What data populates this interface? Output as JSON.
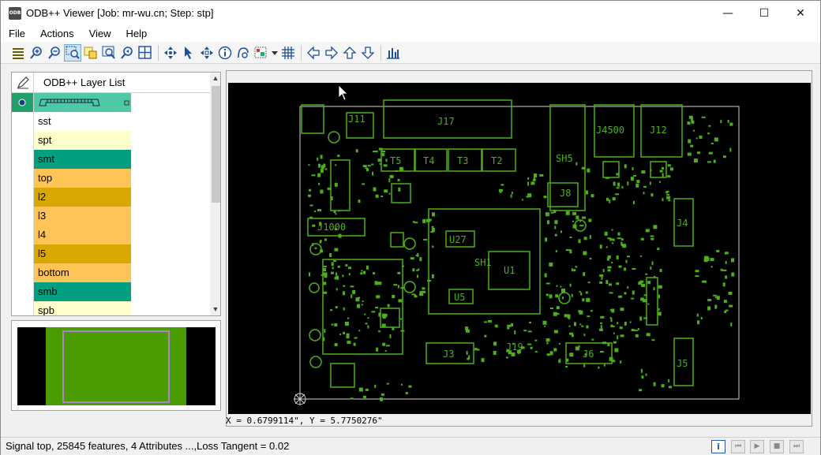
{
  "window": {
    "app_icon_text": "ODB",
    "title": "ODB++ Viewer [Job: mr-wu.cn; Step: stp]",
    "minimize": "—",
    "maximize": "☐",
    "close": "✕"
  },
  "menu": [
    "File",
    "Actions",
    "View",
    "Help"
  ],
  "toolbar": {
    "icons": [
      "layers-icon",
      "zoom-in-icon",
      "zoom-out-icon",
      "zoom-window-icon",
      "zoom-selected-icon",
      "zoom-fit-icon",
      "zoom-previous-icon",
      "panel-layout-icon",
      "sep",
      "move-icon",
      "select-pointer-icon",
      "multi-move-icon",
      "info-icon",
      "measure-icon",
      "highlight-icon",
      "dropdown-arrow-icon",
      "grid-icon",
      "sep",
      "pan-left-icon",
      "pan-right-icon",
      "pan-up-icon",
      "pan-down-icon",
      "sep",
      "histogram-icon"
    ]
  },
  "layer_panel": {
    "header_title": "ODB++ Layer List",
    "layers": [
      {
        "name": "",
        "color": "#4fc9a5",
        "selected": true
      },
      {
        "name": "sst",
        "color": "#ffffff"
      },
      {
        "name": "spt",
        "color": "#ffffcc"
      },
      {
        "name": "smt",
        "color": "#00a080"
      },
      {
        "name": "top",
        "color": "#ffc457"
      },
      {
        "name": "l2",
        "color": "#d9a800"
      },
      {
        "name": "l3",
        "color": "#ffc457"
      },
      {
        "name": "l4",
        "color": "#ffc457"
      },
      {
        "name": "l5",
        "color": "#d9a800"
      },
      {
        "name": "bottom",
        "color": "#ffc457"
      },
      {
        "name": "smb",
        "color": "#00a080"
      },
      {
        "name": "spb",
        "color": "#ffffcc"
      }
    ]
  },
  "board": {
    "trace_color": "#4db01a",
    "labels": [
      "J11",
      "J17",
      "T5",
      "T4",
      "T3",
      "T2",
      "SH5",
      "J4500",
      "J12",
      "J8",
      "J1000",
      "U27",
      "SH1",
      "U1",
      "U5",
      "J4",
      "J3",
      "J19",
      "J6",
      "J5"
    ]
  },
  "coordinates": "X = 0.6799114\", Y = 5.7750276\"",
  "status": {
    "text": "Signal top, 25845 features, 4 Attributes ...,Loss Tangent = 0.02",
    "info_label": "i",
    "nav": [
      "⏮",
      "▶",
      "■",
      "⏭"
    ]
  }
}
